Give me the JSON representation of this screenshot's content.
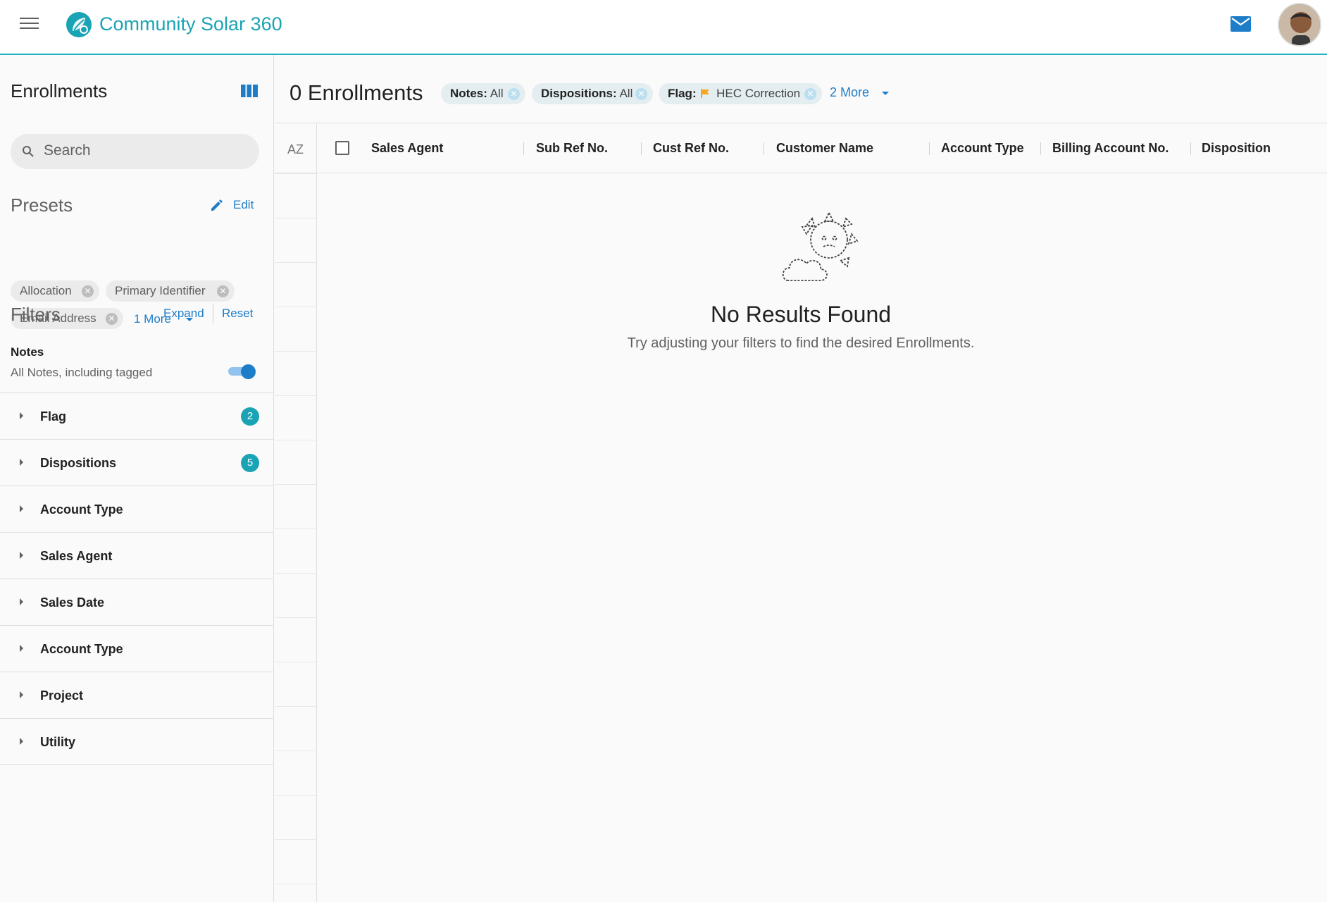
{
  "header": {
    "app_title": "Community Solar 360",
    "icons": [
      "menu-icon",
      "logo-icon",
      "mail-icon",
      "avatar"
    ]
  },
  "sidebar": {
    "title": "Enrollments",
    "search_placeholder": "Search",
    "presets": {
      "heading": "Presets",
      "edit_label": "Edit",
      "chips": [
        "Allocation",
        "Primary Identifier",
        "Email Address"
      ],
      "more_label": "1 More"
    },
    "filters": {
      "heading": "Filters",
      "expand_label": "Expand",
      "reset_label": "Reset",
      "notes_label": "Notes",
      "notes_sub": "All Notes, including tagged",
      "notes_toggle_on": true,
      "items": [
        {
          "label": "Flag",
          "badge": "2"
        },
        {
          "label": "Dispositions",
          "badge": "5"
        },
        {
          "label": "Account Type",
          "badge": ""
        },
        {
          "label": "Sales Agent",
          "badge": ""
        },
        {
          "label": "Sales Date",
          "badge": ""
        },
        {
          "label": "Account Type",
          "badge": ""
        },
        {
          "label": "Project",
          "badge": ""
        },
        {
          "label": "Utility",
          "badge": ""
        }
      ]
    }
  },
  "main": {
    "title": "0 Enrollments",
    "active_filters": [
      {
        "key": "Notes:",
        "value": "All"
      },
      {
        "key": "Dispositions:",
        "value": "All"
      },
      {
        "key": "Flag:",
        "value": "HEC Correction"
      }
    ],
    "more_filters_label": "2 More",
    "sort_label": "AZ",
    "columns": [
      "Sales Agent",
      "Sub Ref No.",
      "Cust Ref No.",
      "Customer Name",
      "Account Type",
      "Billing Account No.",
      "Disposition"
    ],
    "empty_title": "No Results Found",
    "empty_sub": "Try adjusting your filters to find the desired Enrollments."
  },
  "colors": {
    "brand": "#1aa3b4",
    "link": "#1e7dc9",
    "flag": "#f5a623"
  }
}
